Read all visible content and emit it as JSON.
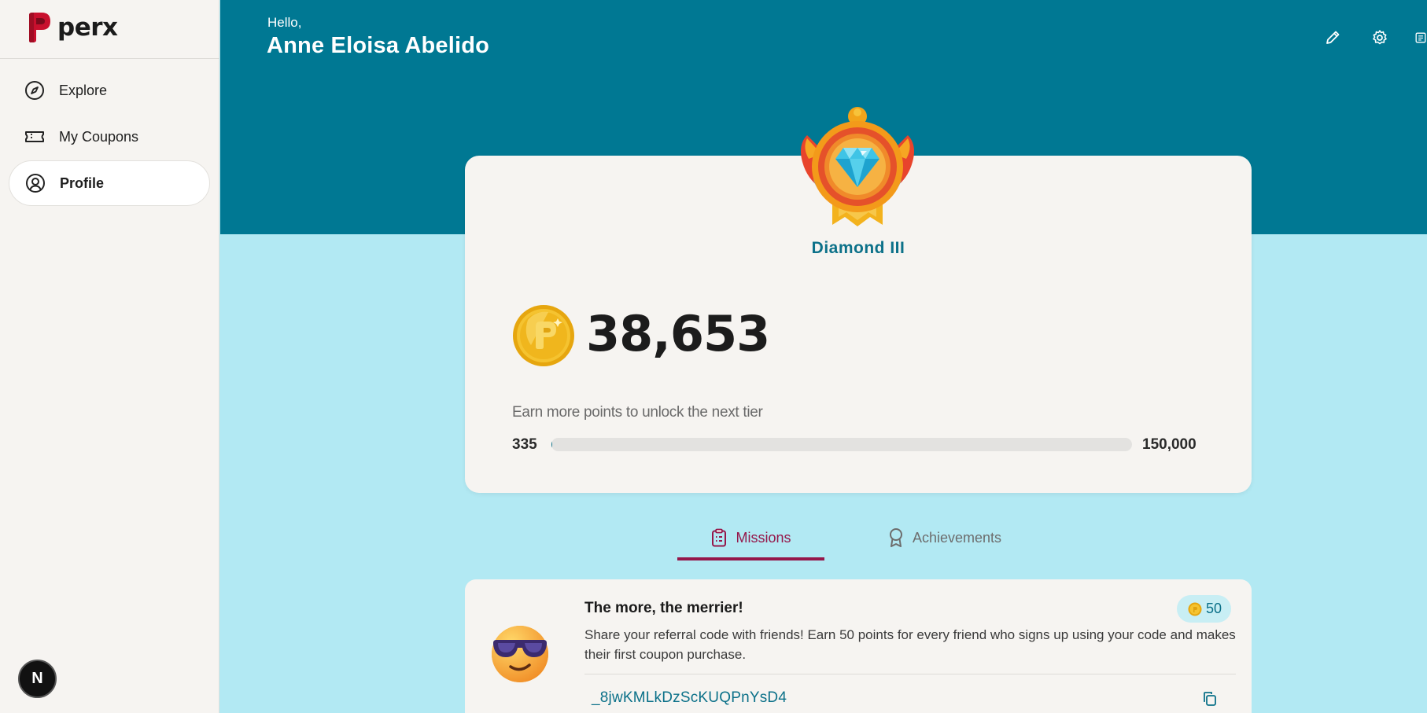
{
  "app": {
    "name": "perx"
  },
  "sidebar": {
    "items": [
      {
        "label": "Explore",
        "icon": "compass-icon",
        "active": false
      },
      {
        "label": "My Coupons",
        "icon": "ticket-icon",
        "active": false
      },
      {
        "label": "Profile",
        "icon": "user-circle-icon",
        "active": true
      }
    ],
    "badge": "N"
  },
  "header": {
    "greeting": "Hello,",
    "user_name": "Anne Eloisa Abelido",
    "actions": [
      "pencil-icon",
      "gear-icon",
      "document-icon"
    ]
  },
  "tier": {
    "name": "Diamond III",
    "points": "38,653",
    "progress_label": "Earn more points to unlock the next tier",
    "progress_min": "335",
    "progress_max": "150,000",
    "progress_fraction": 0.002
  },
  "tabs": [
    {
      "label": "Missions",
      "icon": "clipboard-icon",
      "active": true
    },
    {
      "label": "Achievements",
      "icon": "award-icon",
      "active": false
    }
  ],
  "mission": {
    "title": "The more, the merrier!",
    "reward": "50",
    "description": "Share your referral code with friends! Earn 50 points for every friend who signs up using your code and makes their first coupon purchase.",
    "referral_code": "_8jwKMLkDzScKUQPnYsD4"
  },
  "colors": {
    "accent_teal": "#007893",
    "brand_red": "#c8102e",
    "tab_active": "#95174a",
    "background": "#b2e9f3"
  }
}
